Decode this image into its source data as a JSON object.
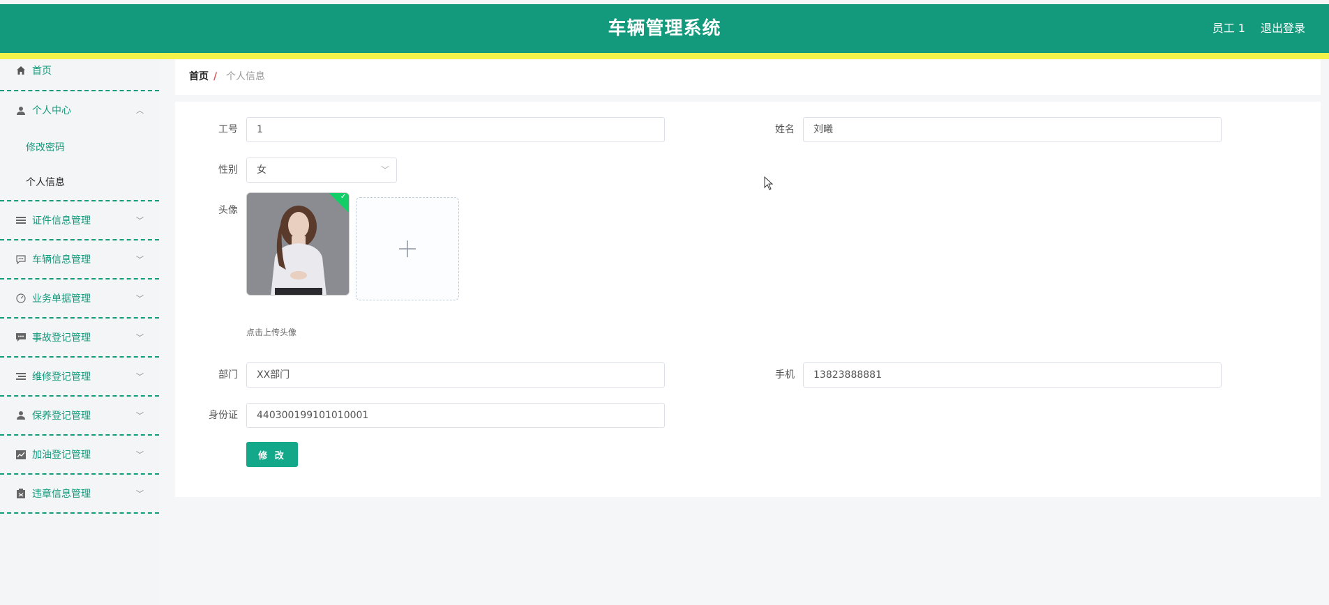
{
  "header": {
    "title": "车辆管理系统",
    "user": "员工 1",
    "logout": "退出登录",
    "bg_color": "#13997b",
    "stripe_color": "#f2f24a"
  },
  "sidebar": {
    "home": {
      "label": "首页",
      "icon": "home-icon"
    },
    "personal_center": {
      "label": "个人中心",
      "icon": "user-icon",
      "children": [
        "修改密码",
        "个人信息"
      ]
    },
    "items": [
      {
        "label": "证件信息管理",
        "icon": "list-icon"
      },
      {
        "label": "车辆信息管理",
        "icon": "chat-icon"
      },
      {
        "label": "业务单据管理",
        "icon": "gauge-icon"
      },
      {
        "label": "事故登记管理",
        "icon": "message-icon"
      },
      {
        "label": "维修登记管理",
        "icon": "list-icon"
      },
      {
        "label": "保养登记管理",
        "icon": "person-icon"
      },
      {
        "label": "加油登记管理",
        "icon": "chart-icon"
      },
      {
        "label": "违章信息管理",
        "icon": "clipboard-icon"
      }
    ]
  },
  "breadcrumb": {
    "home": "首页",
    "separator": "/",
    "current": "个人信息"
  },
  "form": {
    "employee_id": {
      "label": "工号",
      "value": "1"
    },
    "name": {
      "label": "姓名",
      "value": "刘曦"
    },
    "gender": {
      "label": "性别",
      "value": "女"
    },
    "avatar": {
      "label": "头像",
      "hint": "点击上传头像"
    },
    "department": {
      "label": "部门",
      "value": "XX部门"
    },
    "phone": {
      "label": "手机",
      "value": "13823888881"
    },
    "id_card": {
      "label": "身份证",
      "value": "440300199101010001"
    },
    "submit": "修 改"
  }
}
